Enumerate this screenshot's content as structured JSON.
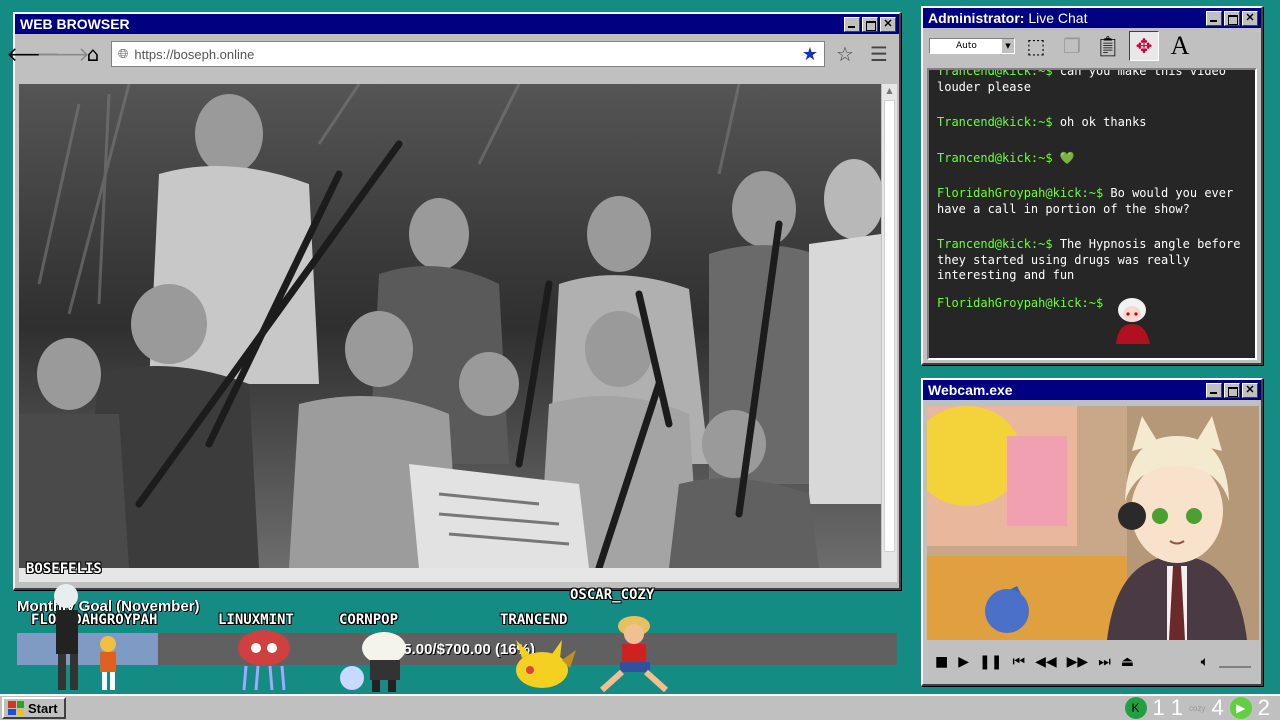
{
  "browser": {
    "title": "WEB BROWSER",
    "url": "https://boseph.online",
    "video_overlay_name": "BOSEFELIS"
  },
  "chat": {
    "title_bold": "Administrator:",
    "title_rest": " Live Chat",
    "font_select": "Auto",
    "messages": [
      {
        "user": "Trancend@kick:~$",
        "text": "can you make this video louder please"
      },
      {
        "user": "Trancend@kick:~$",
        "text": "oh ok thanks"
      },
      {
        "user": "Trancend@kick:~$",
        "text": "💚"
      },
      {
        "user": "FloridahGroypah@kick:~$",
        "text": "Bo would you ever have a call in portion of the show?"
      },
      {
        "user": "Trancend@kick:~$",
        "text": "The Hypnosis angle before they started using drugs was really interesting and fun"
      },
      {
        "user": "FloridahGroypah@kick:~$",
        "text": ""
      }
    ]
  },
  "webcam": {
    "title": "Webcam.exe"
  },
  "goal": {
    "title": "Monthly Goal (November)",
    "text": "$115.00/$700.00 (16%)",
    "progress": 0.16,
    "participants": [
      "FLORIDAHGROYPAH",
      "LINUXMINT",
      "CORNPOP",
      "TRANCEND",
      "OSCAR_COZY"
    ]
  },
  "taskbar": {
    "start_label": "Start",
    "tray_numbers": [
      "1",
      "1",
      "4",
      "2"
    ],
    "tray_small_label": "cozy"
  },
  "colors": {
    "desktop": "#148c84",
    "titlebar": "#000080",
    "chat_user": "#6cff3a",
    "chat_bg": "#262626"
  }
}
